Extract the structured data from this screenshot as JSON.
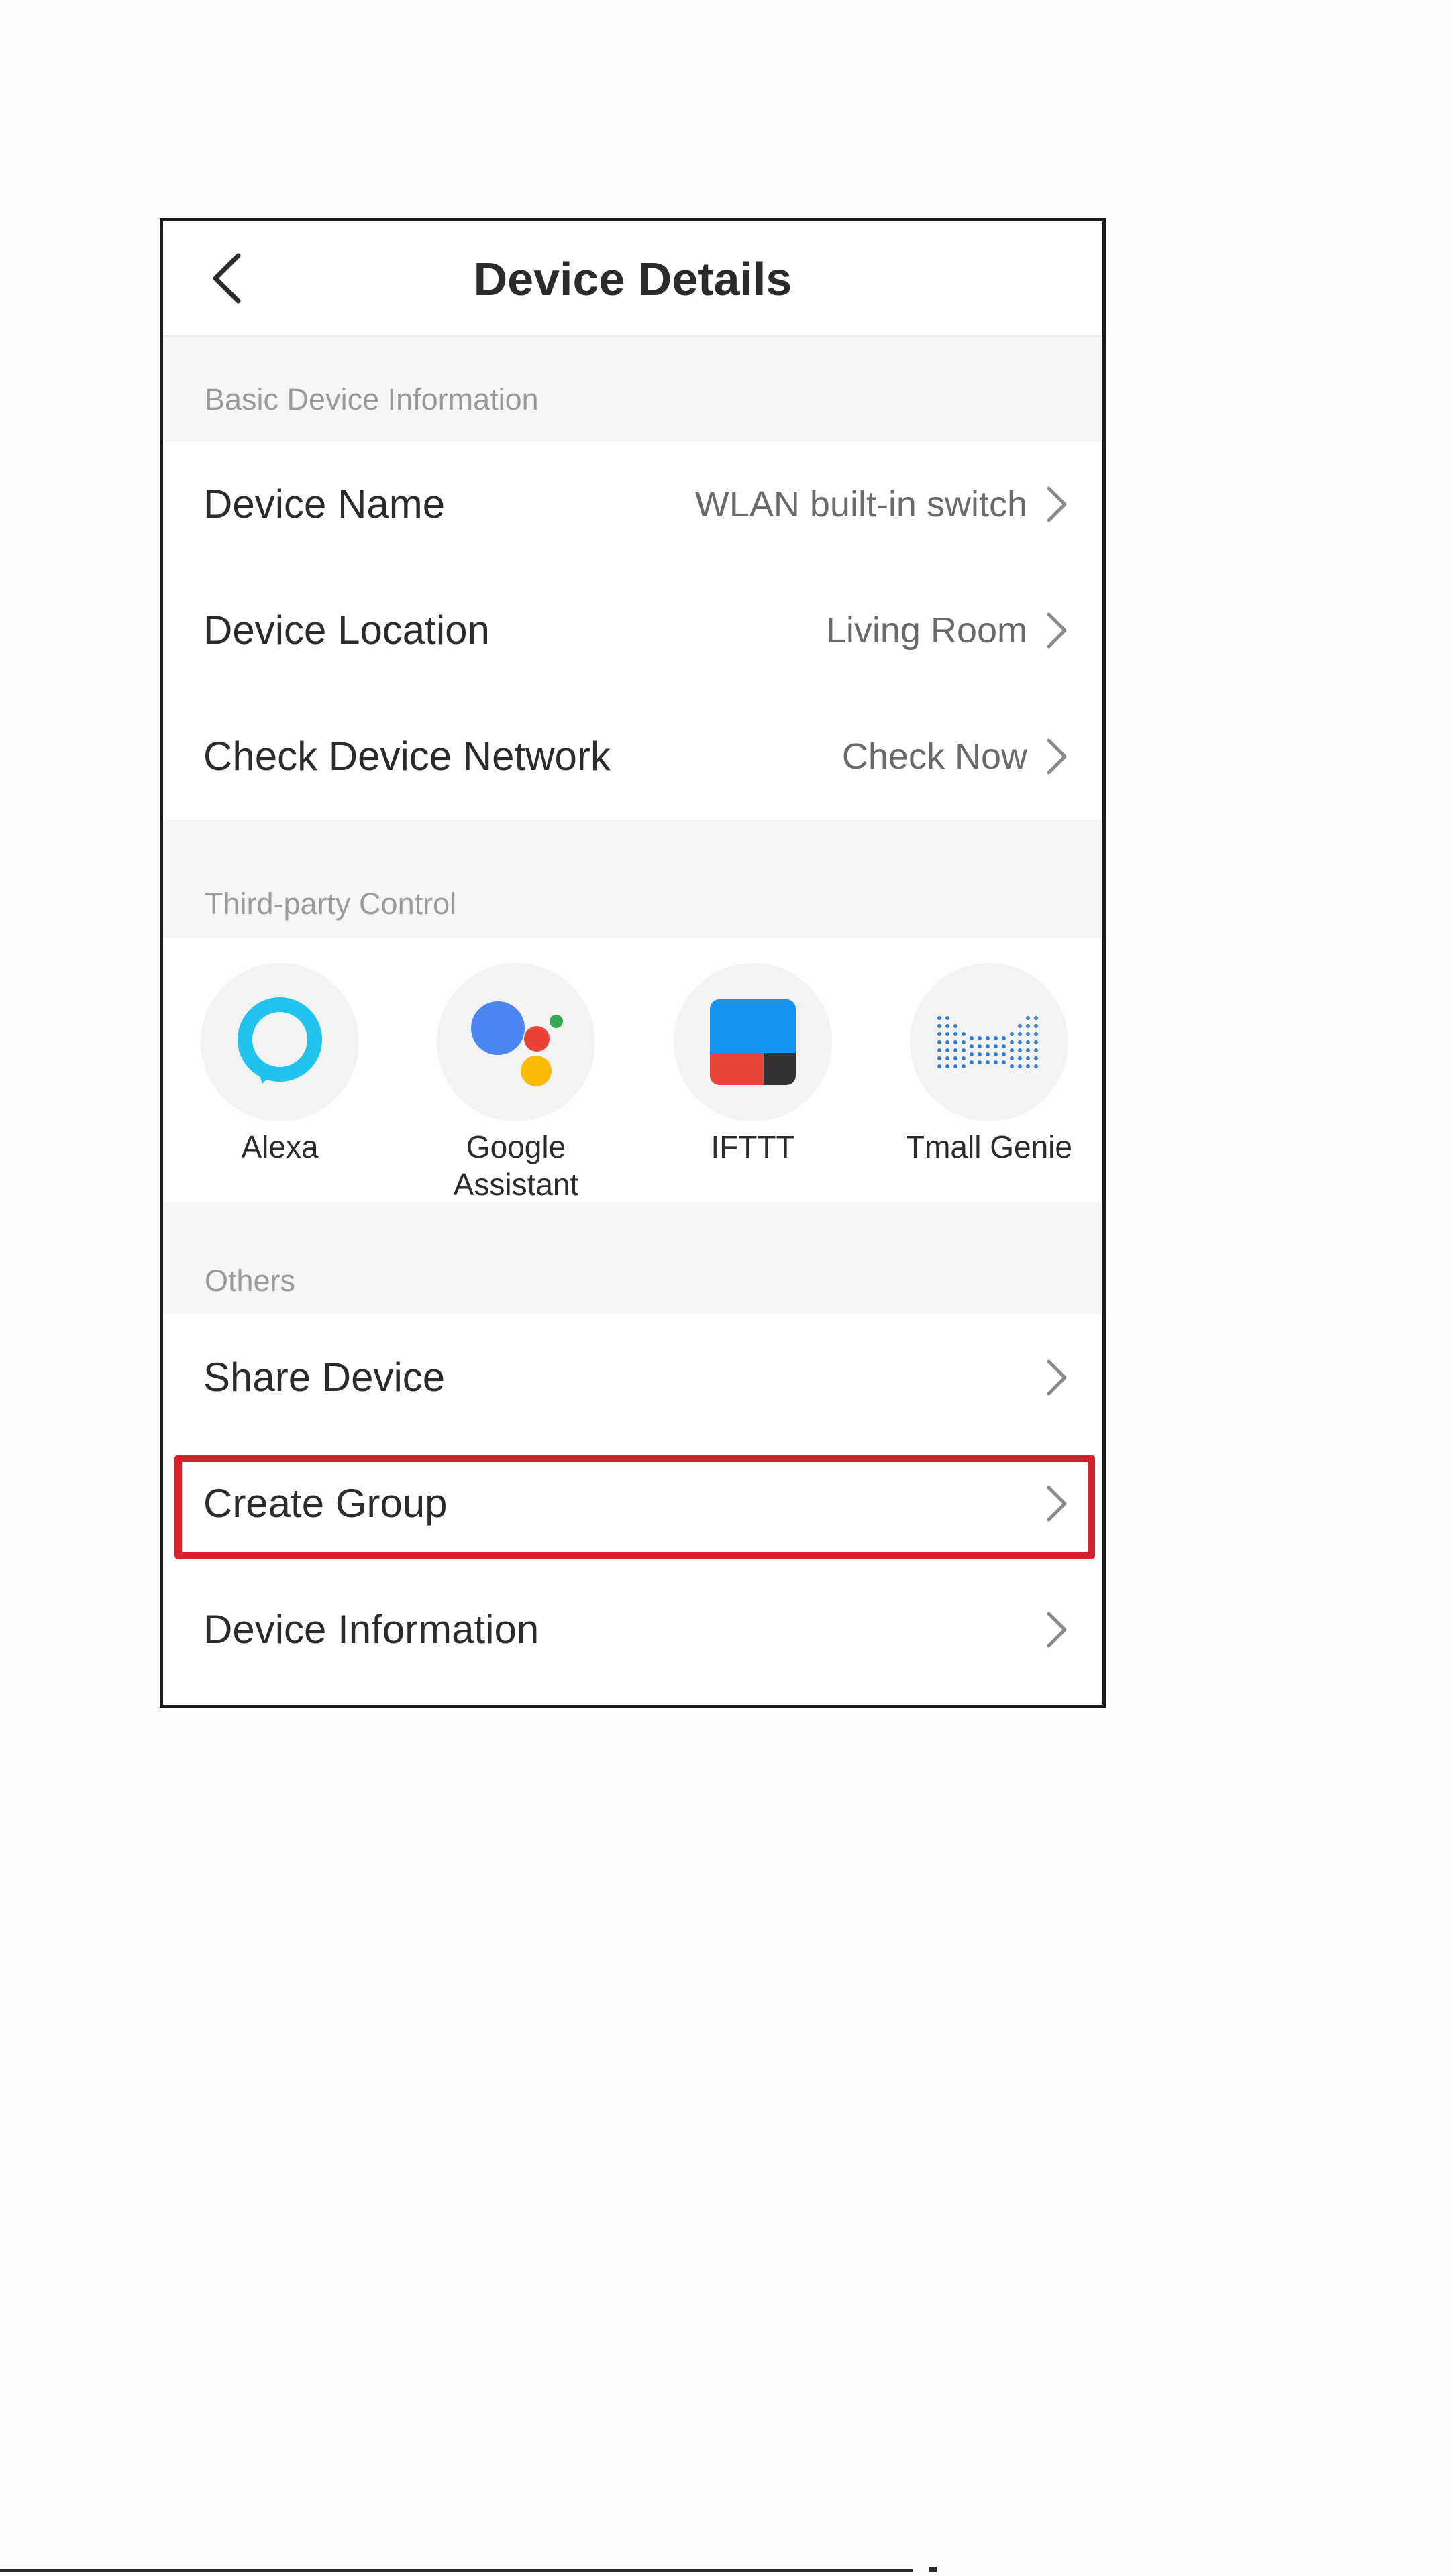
{
  "header": {
    "title": "Device Details",
    "back_icon": "chevron-left-icon"
  },
  "sections": {
    "basic": {
      "title": "Basic Device Information",
      "rows": [
        {
          "label": "Device Name",
          "value": "WLAN built-in switch"
        },
        {
          "label": "Device Location",
          "value": "Living Room"
        },
        {
          "label": "Check Device Network",
          "value": "Check Now"
        }
      ]
    },
    "third_party": {
      "title": "Third-party Control",
      "items": [
        {
          "label": "Alexa",
          "icon": "alexa-icon"
        },
        {
          "label_line1": "Google",
          "label_line2": "Assistant",
          "icon": "google-assistant-icon"
        },
        {
          "label": "IFTTT",
          "icon": "ifttt-icon"
        },
        {
          "label": "Tmall Genie",
          "icon": "tmall-genie-icon"
        }
      ]
    },
    "others": {
      "title": "Others",
      "rows": [
        {
          "label": "Share Device"
        },
        {
          "label": "Create Group"
        },
        {
          "label": "Device Information"
        }
      ]
    }
  },
  "colors": {
    "highlight": "#d4222c",
    "section_bg": "#f6f6f6",
    "alexa": "#1fc3ec",
    "google_blue": "#4a86f0",
    "google_red": "#ea4335",
    "google_yellow": "#fbbc05",
    "google_green": "#34a853",
    "ifttt_blue": "#1396f3",
    "ifttt_red": "#e9453a",
    "ifttt_dark": "#333333",
    "tmall": "#2f7fd8"
  }
}
